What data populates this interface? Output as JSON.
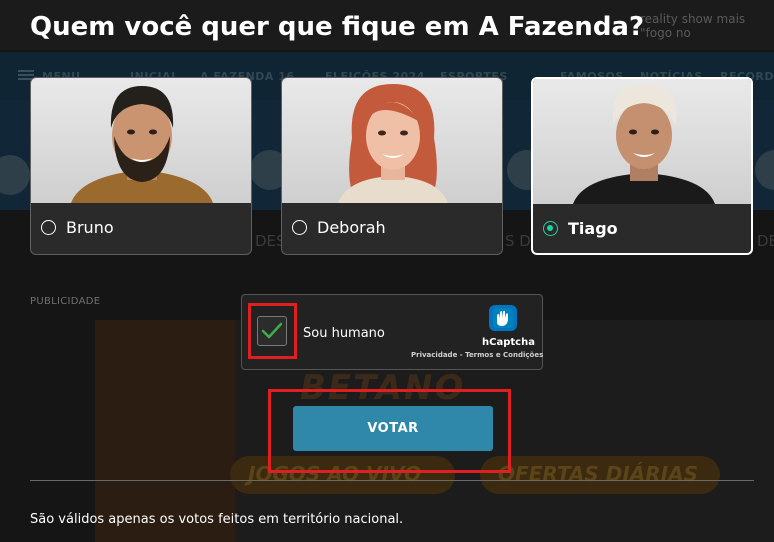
{
  "background": {
    "top_note": "reality show mais \"fogo no",
    "nav_items": [
      "MENU",
      "INICIAL",
      "A FAZENDA 16",
      "ELEIÇÕES 2024",
      "ESPORTES",
      "FAMOSOS",
      "NOTÍCIAS",
      "RECORD TV"
    ],
    "fragment_left": "DES",
    "fragment_mid": "S D",
    "fragment_right": "DE",
    "ad_brand": "BETANO",
    "ad_pill_1": "JOGOS AO VIVO",
    "ad_pill_2": "OFERTAS DIÁRIAS"
  },
  "poll": {
    "title": "Quem você quer que fique em A Fazenda?",
    "candidates": [
      {
        "name": "Bruno",
        "selected": false
      },
      {
        "name": "Deborah",
        "selected": false
      },
      {
        "name": "Tiago",
        "selected": true
      }
    ],
    "ad_label": "PUBLICIDADE",
    "captcha": {
      "label": "Sou humano",
      "checked": true,
      "brand": "hCaptcha",
      "privacy": "Privacidade",
      "separator": " - ",
      "terms": "Termos e Condições"
    },
    "vote_button": "VOTAR",
    "footnote": "São válidos apenas os votos feitos em território nacional."
  },
  "colors": {
    "accent": "#2f88aa",
    "radio_selected": "#1fd2a5",
    "highlight": "#e02020",
    "check": "#3fae49"
  }
}
